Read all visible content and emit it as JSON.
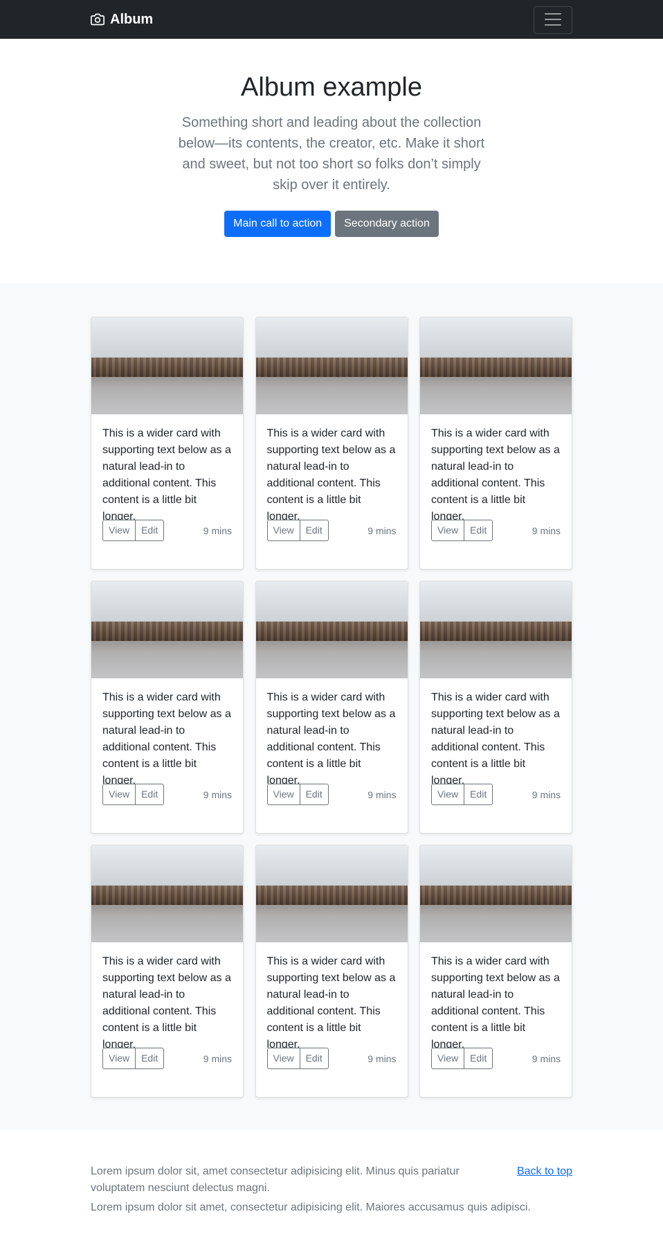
{
  "navbar": {
    "brand": "Album",
    "brand_icon": "camera-icon",
    "toggler_icon": "hamburger-menu-icon"
  },
  "hero": {
    "title": "Album example",
    "lead": "Something short and leading about the collection below—its contents, the creator, etc. Make it short and sweet, but not too short so folks don’t simply skip over it entirely.",
    "primary_label": "Main call to action",
    "secondary_label": "Secondary action"
  },
  "cards": [
    {
      "text": "This is a wider card with supporting text below as a natural lead-in to additional content. This content is a little bit longer.",
      "view_label": "View",
      "edit_label": "Edit",
      "time": "9 mins"
    },
    {
      "text": "This is a wider card with supporting text below as a natural lead-in to additional content. This content is a little bit longer.",
      "view_label": "View",
      "edit_label": "Edit",
      "time": "9 mins"
    },
    {
      "text": "This is a wider card with supporting text below as a natural lead-in to additional content. This content is a little bit longer.",
      "view_label": "View",
      "edit_label": "Edit",
      "time": "9 mins"
    },
    {
      "text": "This is a wider card with supporting text below as a natural lead-in to additional content. This content is a little bit longer.",
      "view_label": "View",
      "edit_label": "Edit",
      "time": "9 mins"
    },
    {
      "text": "This is a wider card with supporting text below as a natural lead-in to additional content. This content is a little bit longer.",
      "view_label": "View",
      "edit_label": "Edit",
      "time": "9 mins"
    },
    {
      "text": "This is a wider card with supporting text below as a natural lead-in to additional content. This content is a little bit longer.",
      "view_label": "View",
      "edit_label": "Edit",
      "time": "9 mins"
    },
    {
      "text": "This is a wider card with supporting text below as a natural lead-in to additional content. This content is a little bit longer.",
      "view_label": "View",
      "edit_label": "Edit",
      "time": "9 mins"
    },
    {
      "text": "This is a wider card with supporting text below as a natural lead-in to additional content. This content is a little bit longer.",
      "view_label": "View",
      "edit_label": "Edit",
      "time": "9 mins"
    },
    {
      "text": "This is a wider card with supporting text below as a natural lead-in to additional content. This content is a little bit longer.",
      "view_label": "View",
      "edit_label": "Edit",
      "time": "9 mins"
    }
  ],
  "footer": {
    "back_to_top": "Back to top",
    "line1": "Lorem ipsum dolor sit, amet consectetur adipisicing elit. Minus quis pariatur voluptatem nesciunt delectus magni.",
    "line2": "Lorem ipsum dolor sit amet, consectetur adipisicing elit. Maiores accusamus quis adipisci."
  },
  "colors": {
    "navbar_bg": "#212529",
    "primary": "#0d6efd",
    "secondary": "#6c757d",
    "album_bg": "#f8f9fa"
  }
}
